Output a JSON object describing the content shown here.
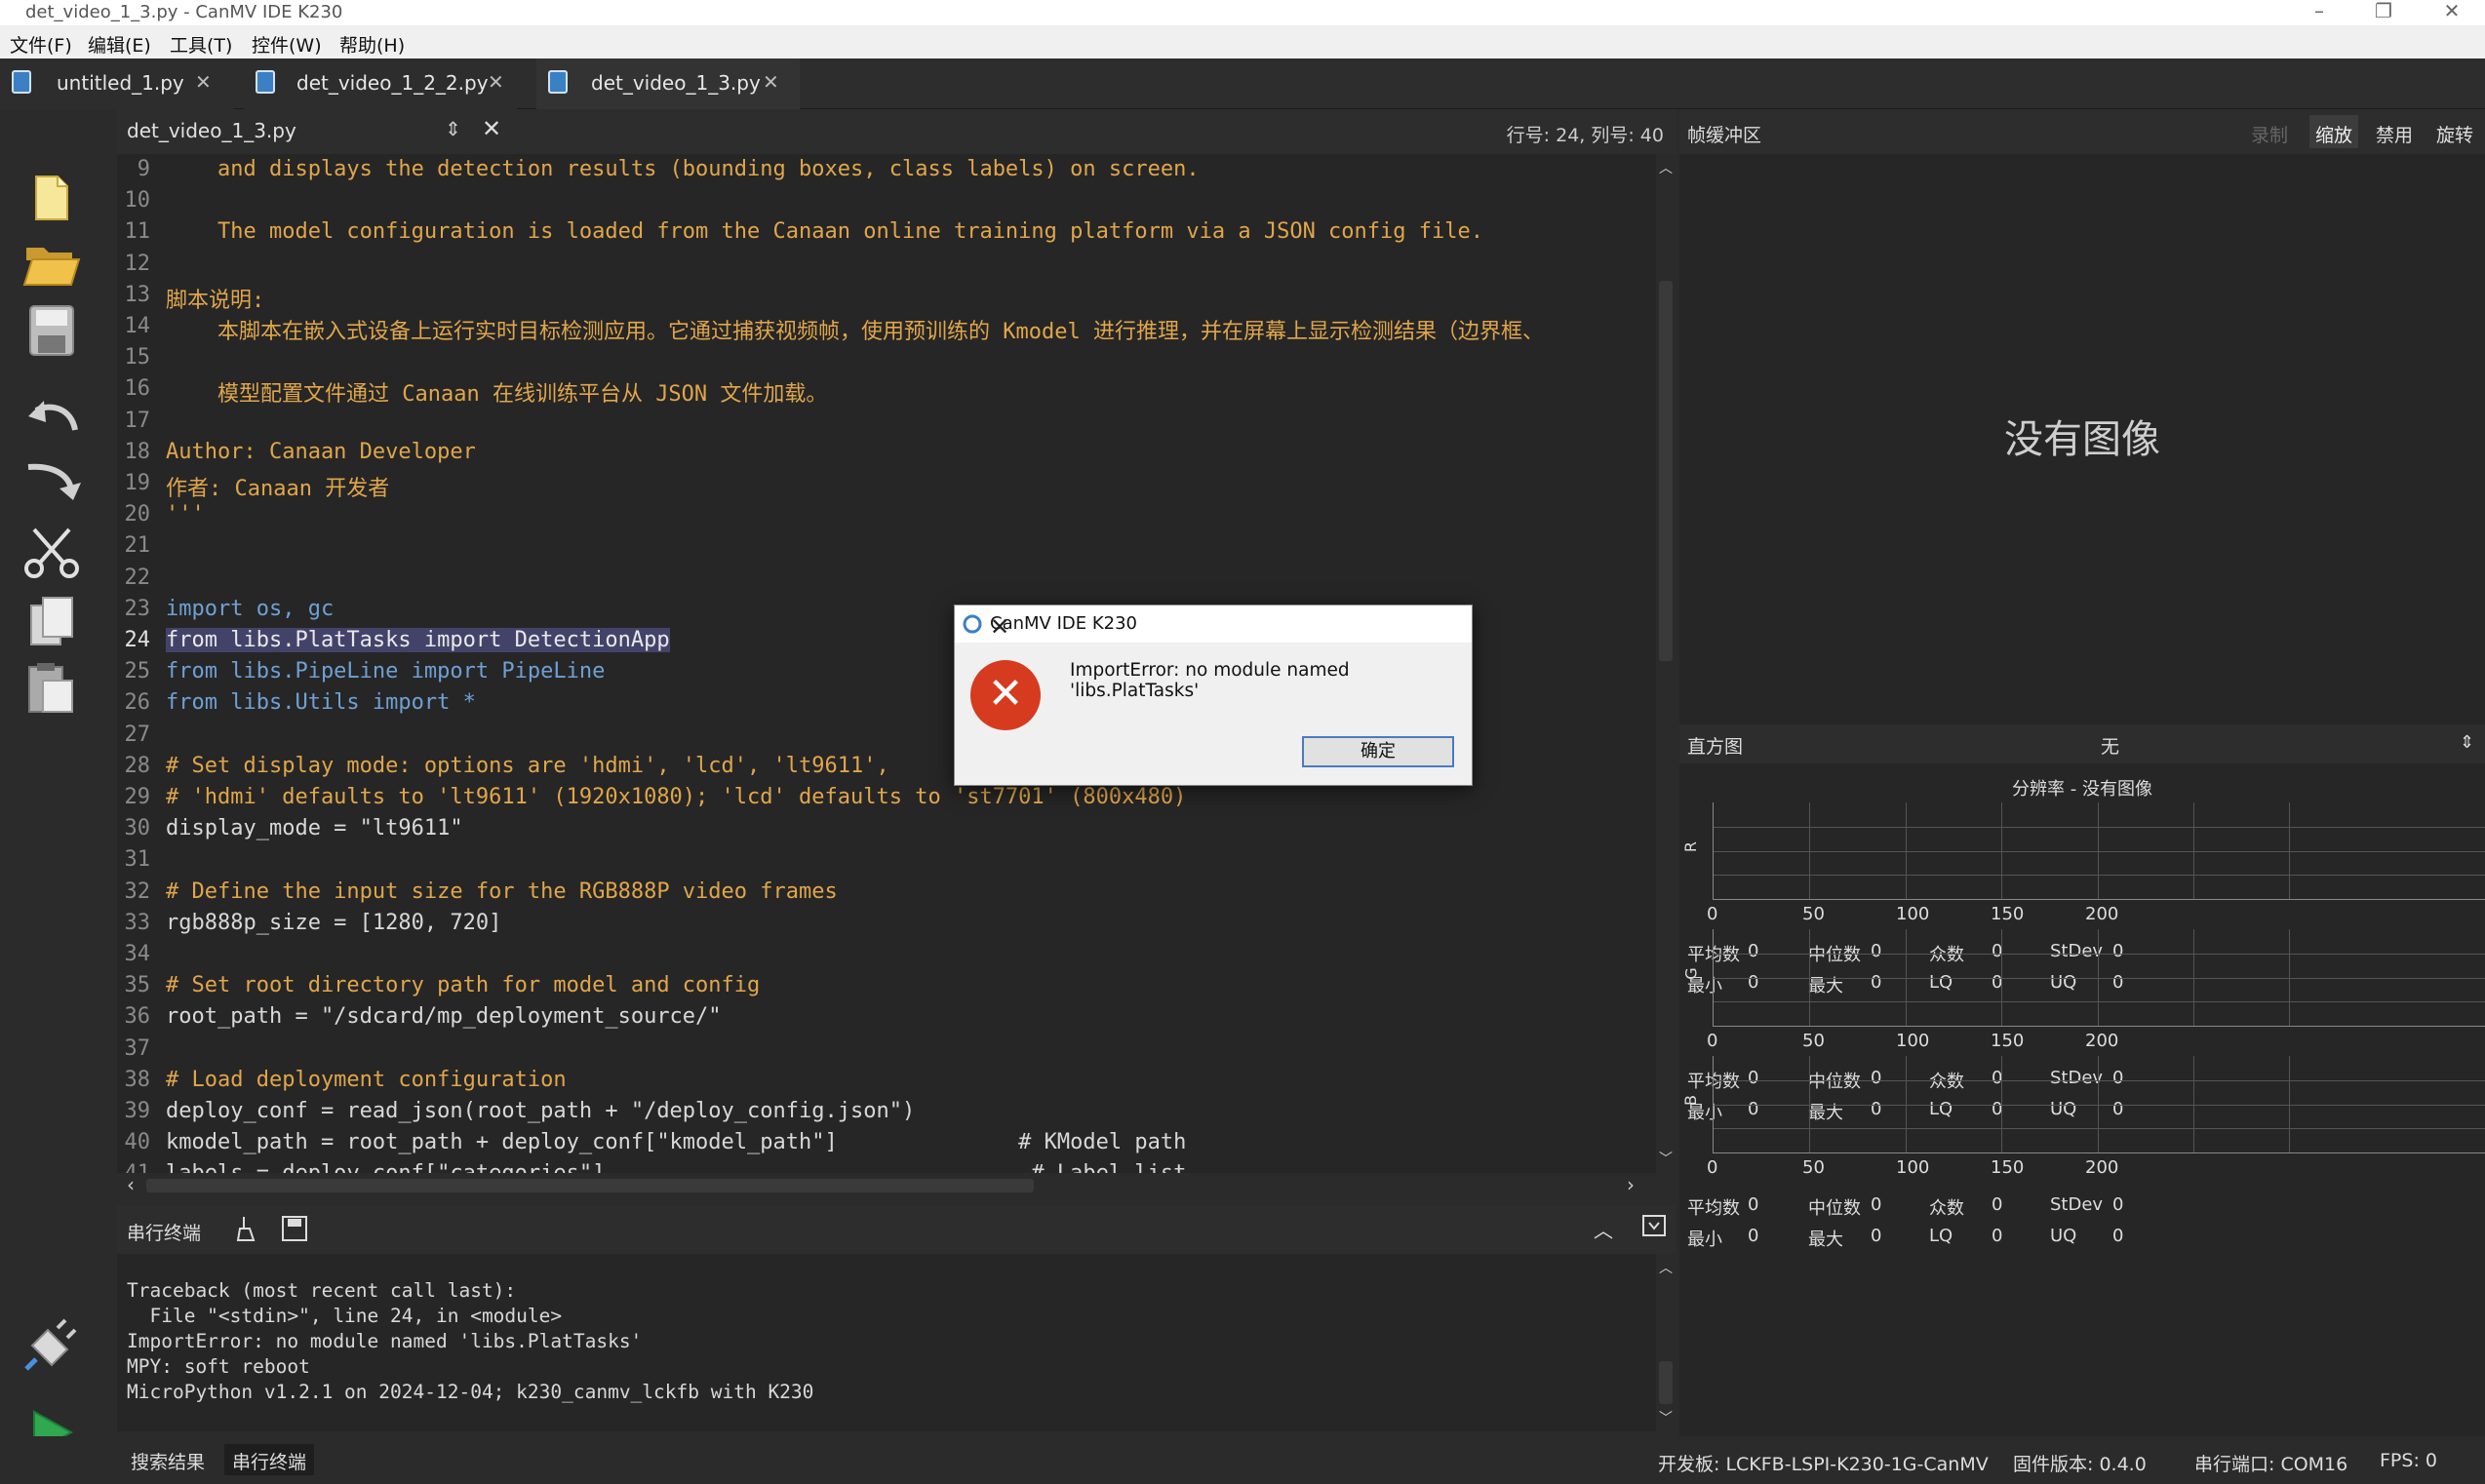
{
  "window": {
    "title": "det_video_1_3.py - CanMV IDE K230"
  },
  "menu": [
    "文件(F)",
    "编辑(E)",
    "工具(T)",
    "控件(W)",
    "帮助(H)"
  ],
  "tabs": [
    {
      "label": "untitled_1.py"
    },
    {
      "label": "det_video_1_2_2.py"
    },
    {
      "label": "det_video_1_3.py"
    }
  ],
  "editor": {
    "file": "det_video_1_3.py",
    "position": "行号: 24, 列号: 40",
    "lines": [
      {
        "n": "9",
        "t": "    and displays the detection results (bounding boxes, class labels) on screen."
      },
      {
        "n": "10",
        "t": ""
      },
      {
        "n": "11",
        "t": "    The model configuration is loaded from the Canaan online training platform via a JSON config file."
      },
      {
        "n": "12",
        "t": ""
      },
      {
        "n": "13",
        "t": "脚本说明:"
      },
      {
        "n": "14",
        "t": "    本脚本在嵌入式设备上运行实时目标检测应用。它通过捕获视频帧，使用预训练的 Kmodel 进行推理，并在屏幕上显示检测结果（边界框、"
      },
      {
        "n": "15",
        "t": ""
      },
      {
        "n": "16",
        "t": "    模型配置文件通过 Canaan 在线训练平台从 JSON 文件加载。"
      },
      {
        "n": "17",
        "t": ""
      },
      {
        "n": "18",
        "t": "Author: Canaan Developer"
      },
      {
        "n": "19",
        "t": "作者: Canaan 开发者"
      },
      {
        "n": "20",
        "t": "'''"
      },
      {
        "n": "21",
        "t": ""
      },
      {
        "n": "22",
        "t": ""
      },
      {
        "n": "23",
        "t": "import os, gc"
      },
      {
        "n": "24",
        "t": "from libs.PlatTasks import DetectionApp"
      },
      {
        "n": "25",
        "t": "from libs.PipeLine import PipeLine"
      },
      {
        "n": "26",
        "t": "from libs.Utils import *"
      },
      {
        "n": "27",
        "t": ""
      },
      {
        "n": "28",
        "t": "# Set display mode: options are 'hdmi', 'lcd', 'lt9611',"
      },
      {
        "n": "29",
        "t": "# 'hdmi' defaults to 'lt9611' (1920x1080); 'lcd' defaults to 'st7701' (800x480)"
      },
      {
        "n": "30",
        "t": "display_mode = \"lt9611\""
      },
      {
        "n": "31",
        "t": ""
      },
      {
        "n": "32",
        "t": "# Define the input size for the RGB888P video frames"
      },
      {
        "n": "33",
        "t": "rgb888p_size = [1280, 720]"
      },
      {
        "n": "34",
        "t": ""
      },
      {
        "n": "35",
        "t": "# Set root directory path for model and config"
      },
      {
        "n": "36",
        "t": "root_path = \"/sdcard/mp_deployment_source/\""
      },
      {
        "n": "37",
        "t": ""
      },
      {
        "n": "38",
        "t": "# Load deployment configuration"
      },
      {
        "n": "39",
        "t": "deploy_conf = read_json(root_path + \"/deploy_config.json\")"
      },
      {
        "n": "40",
        "t": "kmodel_path = root_path + deploy_conf[\"kmodel_path\"]              # KModel path"
      },
      {
        "n": "41",
        "t": "labels = deploy_conf[\"categories\"]                                 # Label list"
      }
    ]
  },
  "framebuffer": {
    "title": "帧缓冲区",
    "buttons": [
      "录制",
      "缩放",
      "禁用",
      "旋转"
    ],
    "no_image": "没有图像"
  },
  "histogram": {
    "label": "直方图",
    "mode": "无",
    "resolution": "分辨率 - 没有图像",
    "ticks": [
      "0",
      "50",
      "100",
      "150",
      "200"
    ],
    "channels": [
      {
        "name": "R"
      },
      {
        "name": "G"
      },
      {
        "name": "B"
      }
    ],
    "stats": {
      "mean": "平均数",
      "median": "中位数",
      "mode": "众数",
      "stdev": "StDev",
      "min": "最小",
      "max": "最大",
      "lq": "LQ",
      "uq": "UQ",
      "value": "0"
    }
  },
  "terminal": {
    "title": "串行终端",
    "lines": [
      "Traceback (most recent call last):",
      "  File \"<stdin>\", line 24, in <module>",
      "ImportError: no module named 'libs.PlatTasks'",
      "MPY: soft reboot",
      "MicroPython v1.2.1 on 2024-12-04; k230_canmv_lckfb with K230"
    ]
  },
  "statusbar": {
    "tab1": "搜索结果",
    "tab2": "串行终端",
    "board": "开发板: LCKFB-LSPI-K230-1G-CanMV",
    "firmware": "固件版本: 0.4.0",
    "port": "串行端口: COM16",
    "fps": "FPS: 0"
  },
  "dialog": {
    "title": "CanMV IDE K230",
    "message": "ImportError: no module named 'libs.PlatTasks'",
    "ok": "确定"
  },
  "colors": {
    "error": "#d63b1f",
    "accent": "#4a7bc0",
    "comment": "#e0a64b",
    "keyword": "#6fa0d4"
  }
}
